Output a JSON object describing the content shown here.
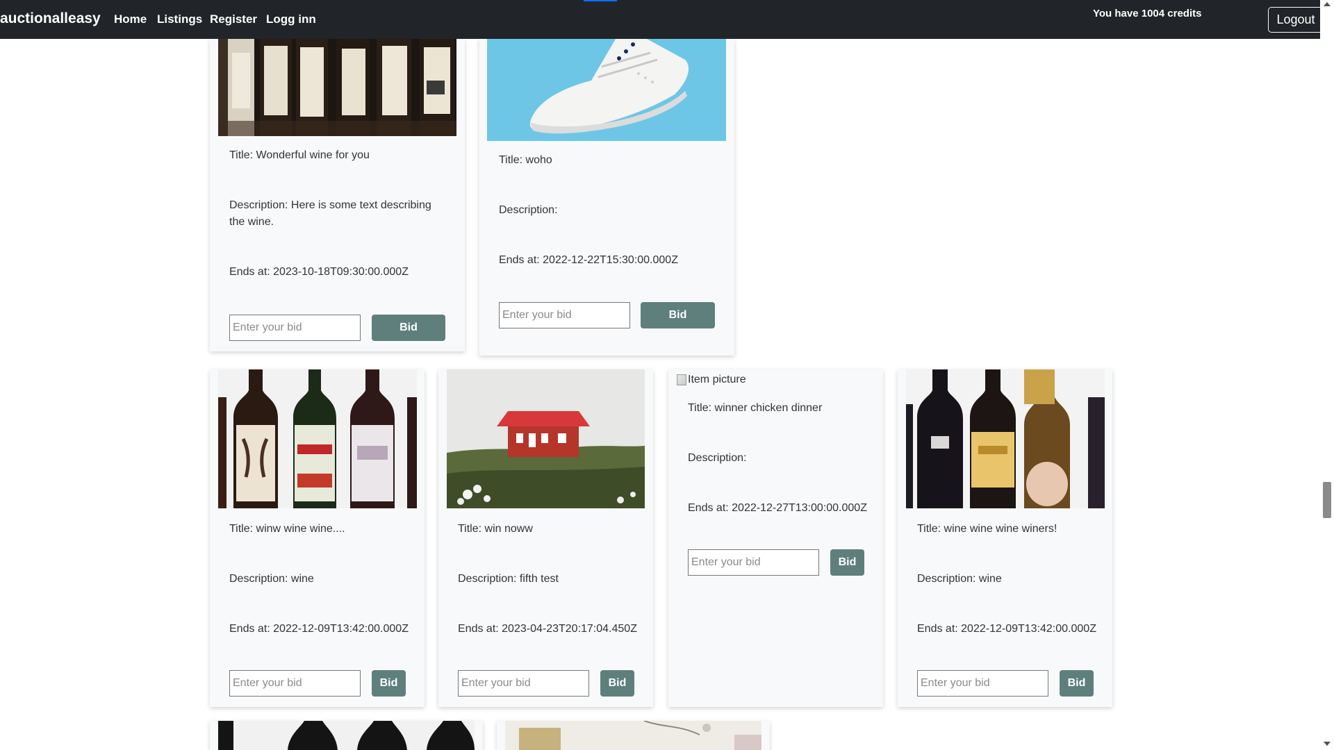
{
  "navbar": {
    "brand": "auctionalleasy",
    "links": [
      "Home",
      "Listings",
      "Register",
      "Logg inn"
    ],
    "credits_text": "You have 1004 credits",
    "logout_label": "Logout"
  },
  "bid": {
    "placeholder": "Enter your bid",
    "button_label": "Bid"
  },
  "broken_image_alt": "Item picture",
  "listings": [
    {
      "title": "Title: Wonderful wine for you",
      "description": "Description: Here is some text describing the wine.",
      "ends": "Ends at: 2023-10-18T09:30:00.000Z"
    },
    {
      "title": "Title: woho",
      "description": "Description:",
      "ends": "Ends at: 2022-12-22T15:30:00.000Z"
    },
    {
      "title": "Title: winw wine wine....",
      "description": "Description: wine",
      "ends": "Ends at: 2022-12-09T13:42:00.000Z"
    },
    {
      "title": "Title: win noww",
      "description": "Description: fifth test",
      "ends": "Ends at: 2023-04-23T20:17:04.450Z"
    },
    {
      "title": "Title: winner chicken dinner",
      "description": "Description:",
      "ends": "Ends at: 2022-12-27T13:00:00.000Z"
    },
    {
      "title": "Title: wine wine wine winers!",
      "description": "Description: wine",
      "ends": "Ends at: 2022-12-09T13:42:00.000Z"
    }
  ]
}
